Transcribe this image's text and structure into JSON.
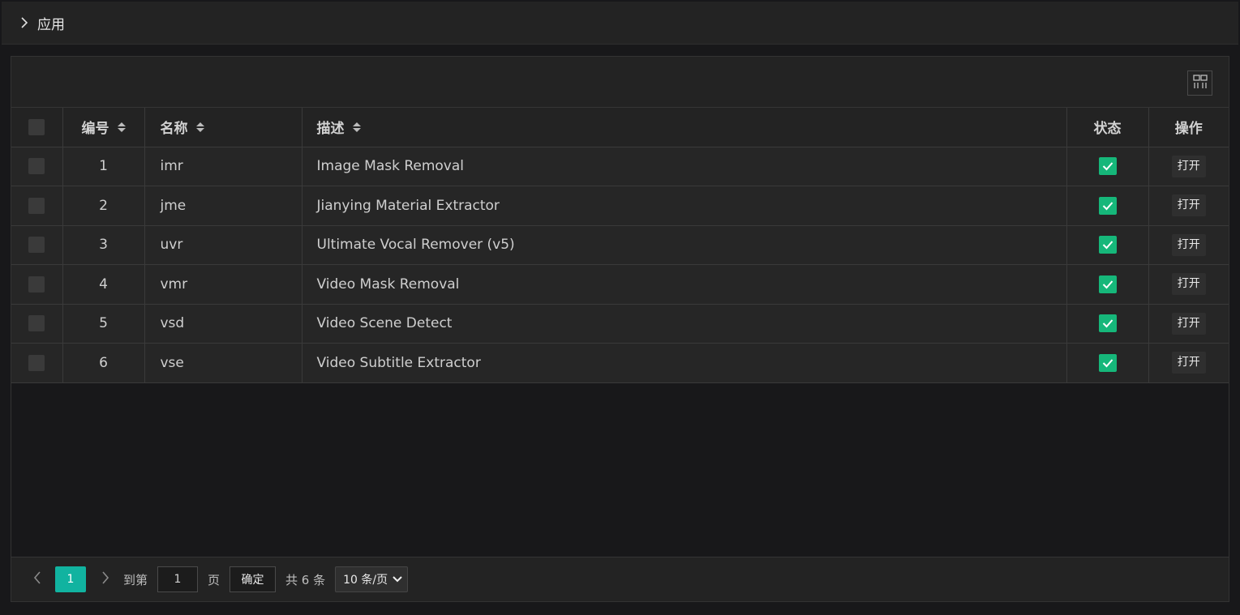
{
  "header": {
    "title": "应用"
  },
  "table": {
    "columns": {
      "id": "编号",
      "name": "名称",
      "desc": "描述",
      "status": "状态",
      "op": "操作"
    },
    "rows": [
      {
        "id": "1",
        "name": "imr",
        "desc": "Image Mask Removal",
        "enabled": true,
        "action": "打开"
      },
      {
        "id": "2",
        "name": "jme",
        "desc": "Jianying Material Extractor",
        "enabled": true,
        "action": "打开"
      },
      {
        "id": "3",
        "name": "uvr",
        "desc": "Ultimate Vocal Remover (v5)",
        "enabled": true,
        "action": "打开"
      },
      {
        "id": "4",
        "name": "vmr",
        "desc": "Video Mask Removal",
        "enabled": true,
        "action": "打开"
      },
      {
        "id": "5",
        "name": "vsd",
        "desc": "Video Scene Detect",
        "enabled": true,
        "action": "打开"
      },
      {
        "id": "6",
        "name": "vse",
        "desc": "Video Subtitle Extractor",
        "enabled": true,
        "action": "打开"
      }
    ]
  },
  "pagination": {
    "current_page": "1",
    "goto_label": "到第",
    "goto_value": "1",
    "page_label": "页",
    "confirm_label": "确定",
    "total_label": "共 6 条",
    "page_size": "10 条/页"
  },
  "colors": {
    "accent": "#11b3a0",
    "status_on": "#16b77a",
    "background": "#18181a"
  },
  "icons": {
    "header": "chevron-right-icon",
    "column_settings": "grid-columns-icon"
  }
}
